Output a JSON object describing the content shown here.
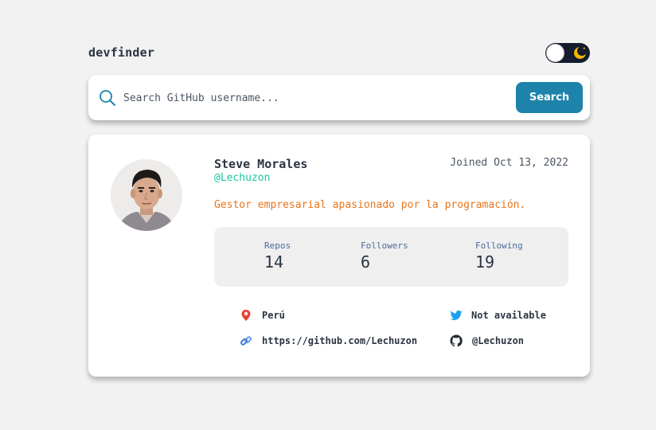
{
  "header": {
    "logo": "devfinder",
    "theme_toggle": {
      "state": "dark",
      "icon": "moon-icon"
    }
  },
  "search": {
    "placeholder": "Search GitHub username...",
    "value": "",
    "button_label": "Search"
  },
  "profile": {
    "name": "Steve Morales",
    "login": "@Lechuzon",
    "joined": "Joined Oct 13, 2022",
    "bio": "Gestor empresarial apasionado por la programación.",
    "stats": [
      {
        "label": "Repos",
        "value": "14"
      },
      {
        "label": "Followers",
        "value": "6"
      },
      {
        "label": "Following",
        "value": "19"
      }
    ],
    "links": {
      "location": "Perú",
      "blog": "https://github.com/Lechuzon",
      "twitter": "Not available",
      "company": "@Lechuzon"
    }
  },
  "colors": {
    "background": "#f2f2f2",
    "accent": "#1d83ab",
    "login": "#18c6a0",
    "bio": "#e8741a",
    "text": "#2b3442"
  }
}
